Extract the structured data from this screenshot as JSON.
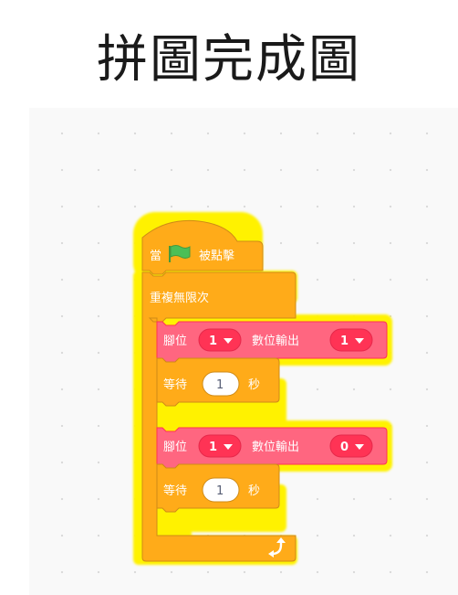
{
  "page": {
    "title": "拼圖完成圖"
  },
  "blocks": {
    "hat": {
      "prefix": "當",
      "flag_icon": "green-flag-icon",
      "suffix": "被點擊"
    },
    "forever": {
      "label": "重複無限次",
      "loop_icon": "loop-arrow-icon"
    },
    "digital_write_1": {
      "pin_label": "腳位",
      "pin_value": "1",
      "output_label": "數位輸出",
      "output_value": "1"
    },
    "wait_1": {
      "label": "等待",
      "value": "1",
      "unit": "秒"
    },
    "digital_write_2": {
      "pin_label": "腳位",
      "pin_value": "1",
      "output_label": "數位輸出",
      "output_value": "0"
    },
    "wait_2": {
      "label": "等待",
      "value": "1",
      "unit": "秒"
    }
  },
  "colors": {
    "control": "#ffab19",
    "control_dark": "#cf8b17",
    "pin_block": "#ff6680",
    "pin_block_dark": "#ff3355",
    "highlight": "#fff200",
    "flag": "#4cbf56",
    "workspace": "#f9f9f9"
  }
}
